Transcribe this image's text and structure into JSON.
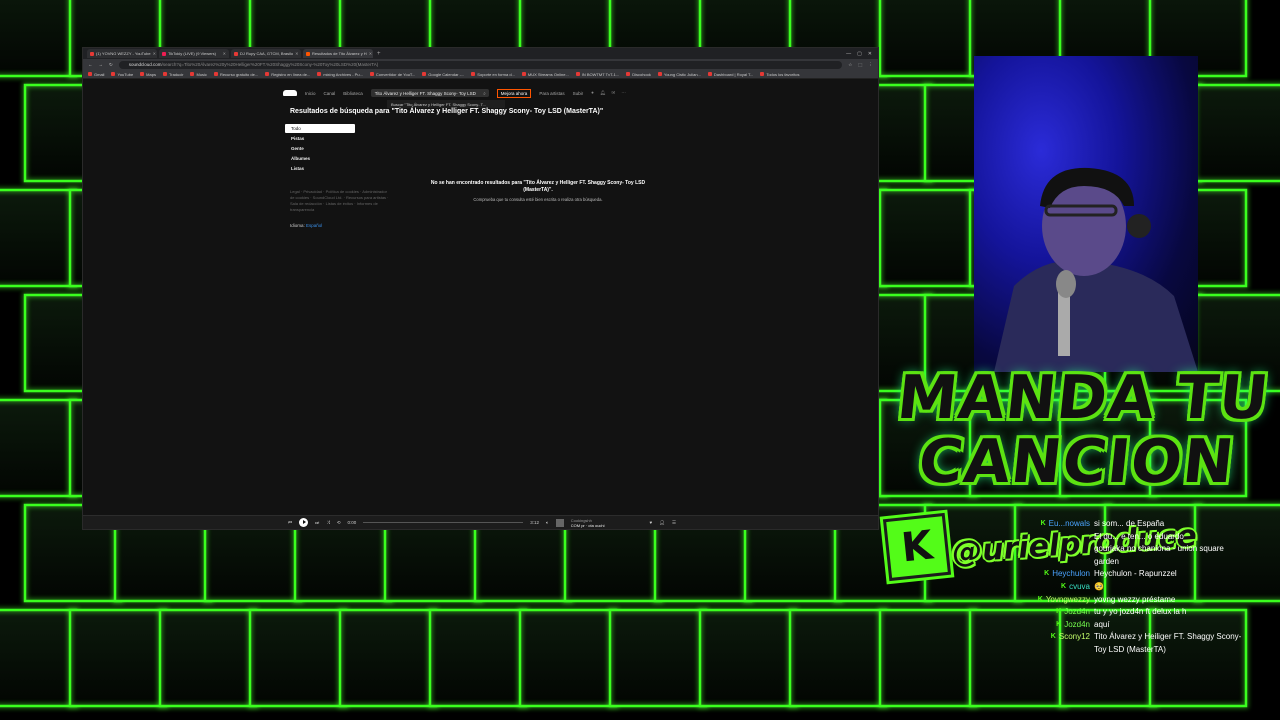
{
  "colors": {
    "neon": "#53fc18",
    "sc_orange": "#ff5500",
    "webcam": "#1a1ab8"
  },
  "browser": {
    "tabs": [
      {
        "label": "(1) YOVNG WEZZY - YouTube",
        "icon": "youtube-icon"
      },
      {
        "label": "TikTokly (LIVE) (9 Viewers)",
        "icon": "tiktok-icon"
      },
      {
        "label": "DJ Rupy CAA, GTCM, Brasilo",
        "icon": "youtube-icon"
      },
      {
        "label": "Resultados de Tito Álvarez y H",
        "icon": "soundcloud-icon"
      }
    ],
    "new_tab": "+",
    "window_controls": [
      "—",
      "▢",
      "✕"
    ],
    "url_host": "soundcloud.com",
    "url_path": "/search?q=Tito%20Álvarez%20y%20Helliger%20FT.%20Shaggy%20Scony-%20Toy%20LSD%20(MasterTA)",
    "bookmarks": [
      "Gmail",
      "YouTube",
      "Maps",
      "Traducir",
      "Music",
      "Recurso gratuito de...",
      "Registro en línea de...",
      "mixing Archives - Pu...",
      "Convertidor de YouT...",
      "Google Calendar -...",
      "Soporte en forma d...",
      "MUX Streams Online...",
      "IN BOWTMT TvT-1...",
      "Discohook",
      "Young Cistic Julian...",
      "Dashboard | Royal T...",
      "Todos los favoritos"
    ]
  },
  "soundcloud": {
    "nav": [
      "Inicio",
      "Canal",
      "Biblioteca"
    ],
    "search_value": "Tito Álvarez y Helliger FT. Shaggy Scony- Toy LSD",
    "suggestion": "Buscar \"Tito Álvarez y Helliger FT. Shaggy Scony- T...",
    "upgrade": "Mejora ahora",
    "artists": "Para artistas",
    "upload": "Subir",
    "results_title": "Resultados de búsqueda para \"Tito Álvarez y Helliger FT. Shaggy Scony- Toy LSD (MasterTA)\"",
    "filters": [
      "Todo",
      "Pistas",
      "Gente",
      "Álbumes",
      "Listas"
    ],
    "footer_links": "Legal · Privacidad · Política de cookies · Administrador de cookies · SoundCloud Ltd. · Recursos para artistas · Sala de redacción · Listas de éxitos · Informes de transparencia",
    "language_label": "Idioma:",
    "language_value": "Español",
    "no_results": "No se han encontrado resultados para \"Tito Álvarez y Helliger FT. Shaggy Scony- Toy LSD (MasterTA)\".",
    "no_results_hint": "Comprueba que tu consulta esté bien escrita o realiza otra búsqueda.",
    "player": {
      "elapsed": "0:00",
      "duration": "3:12",
      "artist": "Cookingshh",
      "title": "COM pr · ota ouchi"
    }
  },
  "overlay": {
    "headline": "MANDA TU CANCION",
    "handle": "@urielproduce",
    "kick_letter": "K"
  },
  "chat": [
    {
      "user": "Eu...nowals",
      "text": "si som... de España",
      "color": "u-blue"
    },
    {
      "user": "",
      "text": "El du... e ten... o eduardo",
      "color": "u-green"
    },
    {
      "user": "",
      "text": "gourjaka no chaniona - union square garden",
      "color": "u-green"
    },
    {
      "user": "Heychulon",
      "text": "Heychulon - Rapunzzel",
      "color": "u-blue"
    },
    {
      "user": "cvuva",
      "text": "🥺",
      "color": "u-cyan"
    },
    {
      "user": "Yovngwezzy",
      "text": "yovng wezzy préstame",
      "color": "u-lime"
    },
    {
      "user": "Jozd4n",
      "text": "tu y yo jozd4n ft delux la h",
      "color": "u-green"
    },
    {
      "user": "Jozd4n",
      "text": "aquí",
      "color": "u-green"
    },
    {
      "user": "Scony12",
      "text": "Tito Álvarez y Heiliger FT. Shaggy Scony- Toy LSD (MasterTA)",
      "color": "u-lime"
    }
  ]
}
